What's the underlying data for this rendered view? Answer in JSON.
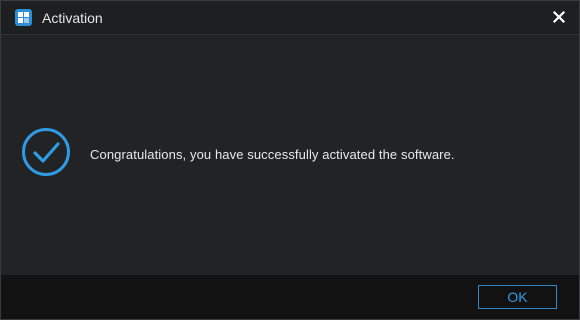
{
  "window": {
    "title": "Activation",
    "app_icon": "app-logo-icon",
    "close_icon": "close-icon"
  },
  "content": {
    "status_icon": "checkmark-circle-icon",
    "message": "Congratulations, you have successfully activated the software."
  },
  "footer": {
    "ok_label": "OK"
  },
  "colors": {
    "accent": "#2f9be6",
    "background": "#222325",
    "footer_background": "#121213",
    "text": "#e8e8e8"
  }
}
